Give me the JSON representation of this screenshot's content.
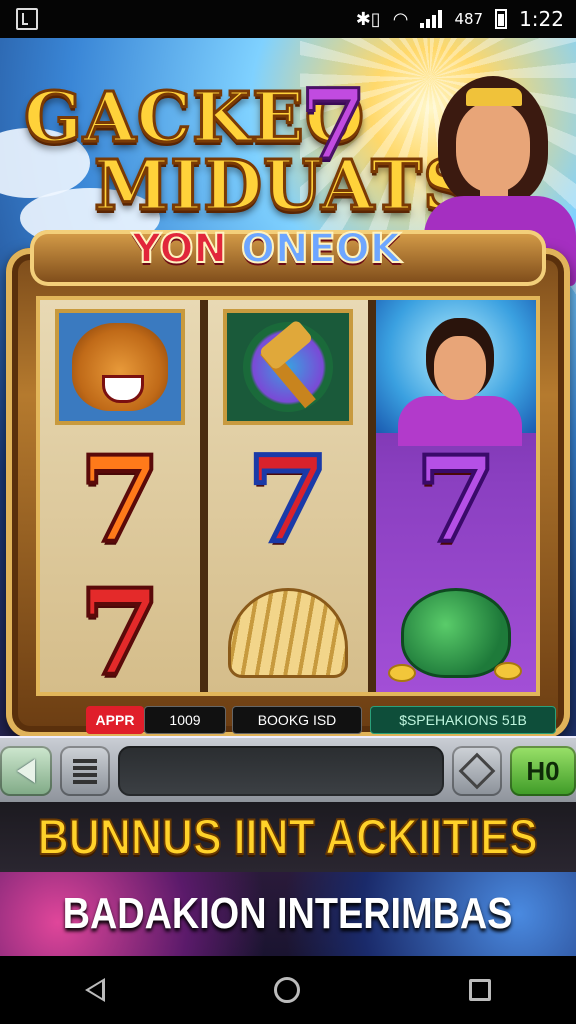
{
  "status_bar": {
    "battery_text": "487",
    "time": "1:22"
  },
  "title": {
    "line1": "GACKEO",
    "seven": "7",
    "line2": "MIDUATS",
    "line3_a": "YON ",
    "line3_b": "ONEOK"
  },
  "reels": [
    [
      "lion-icon",
      "7",
      "7"
    ],
    [
      "gavel-icon",
      "7",
      "shell-icon"
    ],
    [
      "princess-icon",
      "7",
      "pot-icon"
    ]
  ],
  "readouts": {
    "label": "APPR",
    "value": "1009",
    "book": "BOOKG ISD",
    "spec": "$SPEHAKIONS 51B"
  },
  "controls": {
    "go_label": "H0"
  },
  "banners": {
    "line1": "BUNNUS IINT ACKIITIES",
    "line2": "BADAKION INTERIMBAS"
  },
  "colors": {
    "gold": "#ffd22a",
    "frame": "#b57a2e",
    "spec_bg": "#0e4e3a",
    "accent_red": "#e01e2a"
  }
}
